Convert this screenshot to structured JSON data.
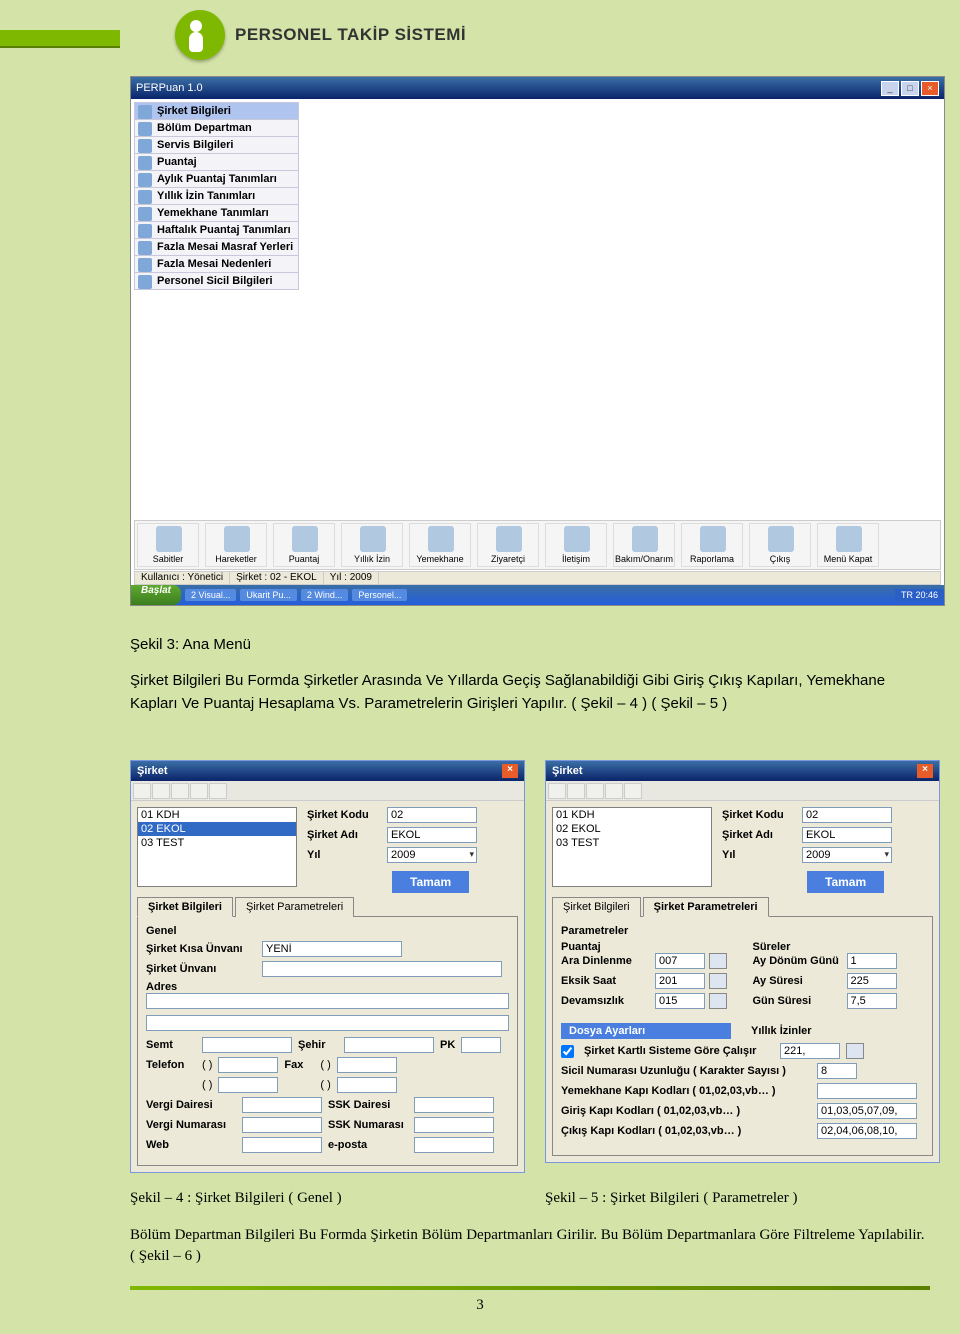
{
  "header": {
    "title": "PERSONEL TAKİP SİSTEMİ"
  },
  "paragraph1_title": "Şekil 3: Ana Menü",
  "paragraph1": "Şirket Bilgileri Bu Formda Şirketler Arasında Ve Yıllarda Geçiş Sağlanabildiği Gibi Giriş Çıkış Kapıları, Yemekhane Kapları Ve Puantaj Hesaplama Vs. Parametrelerin Girişleri Yapılır. ( Şekil – 4 ) ( Şekil – 5 )",
  "caption4": "Şekil – 4 : Şirket Bilgileri ( Genel )",
  "caption5": "Şekil – 5 : Şirket Bilgileri ( Parametreler )",
  "paragraph2": "Bölüm Departman Bilgileri Bu  Formda Şirketin  Bölüm  Departmanları  Girilir. Bu Bölüm Departmanlara Göre Filtreleme Yapılabilir. ( Şekil – 6 )",
  "page_num": "3",
  "mainwin": {
    "title": "PERPuan 1.0",
    "menu": [
      "Şirket Bilgileri",
      "Bölüm Departman",
      "Servis Bilgileri",
      "Puantaj",
      "Aylık Puantaj Tanımları",
      "Yıllık İzin Tanımları",
      "Yemekhane Tanımları",
      "Haftalık Puantaj Tanımları",
      "Fazla Mesai Masraf Yerleri",
      "Fazla Mesai Nedenleri",
      "Personel Sicil Bilgileri"
    ],
    "toolbar": [
      "Sabitler",
      "Hareketler",
      "Puantaj",
      "Yıllık İzin",
      "Yemekhane",
      "Ziyaretçi",
      "İletişim",
      "Bakım/Onarım",
      "Raporlama",
      "Çıkış",
      "Menü Kapat"
    ],
    "status": {
      "user": "Kullanıcı : Yönetici",
      "sirket": "Şirket : 02 - EKOL",
      "yil": "Yıl : 2009"
    },
    "start": "Başlat",
    "tasks": [
      "2 Visual...",
      "Ukarit Pu...",
      "2 Wind...",
      "Personel..."
    ],
    "tray": "TR    20:46"
  },
  "dlgL": {
    "title": "Şirket",
    "list": [
      "01 KDH",
      "02 EKOL",
      "03 TEST"
    ],
    "list_sel_index": 1,
    "kodu_lbl": "Şirket Kodu",
    "kodu": "02",
    "adi_lbl": "Şirket Adı",
    "adi": "EKOL",
    "yil_lbl": "Yıl",
    "yil": "2009",
    "btn": "Tamam",
    "tab1": "Şirket Bilgileri",
    "tab2": "Şirket Parametreleri",
    "grp": "Genel",
    "kisa_lbl": "Şirket Kısa Ünvanı",
    "kisa": "YENİ",
    "unvan_lbl": "Şirket Ünvanı",
    "adres_lbl": "Adres",
    "semt_lbl": "Semt",
    "sehir_lbl": "Şehir",
    "pk_lbl": "PK",
    "tel_lbl": "Telefon",
    "fax_lbl": "Fax",
    "vdairesi_lbl": "Vergi Dairesi",
    "sskd_lbl": "SSK Dairesi",
    "vno_lbl": "Vergi Numarası",
    "sskn_lbl": "SSK Numarası",
    "web_lbl": "Web",
    "email_lbl": "e-posta",
    "paren": "(   )"
  },
  "dlgR": {
    "title": "Şirket",
    "list": [
      "01 KDH",
      "02 EKOL",
      "03 TEST"
    ],
    "kodu_lbl": "Şirket Kodu",
    "kodu": "02",
    "adi_lbl": "Şirket Adı",
    "adi": "EKOL",
    "yil_lbl": "Yıl",
    "yil": "2009",
    "btn": "Tamam",
    "tab1": "Şirket Bilgileri",
    "tab2": "Şirket Parametreleri",
    "grp": "Parametreler",
    "puantaj_hdr": "Puantaj",
    "sureler_hdr": "Süreler",
    "ara_lbl": "Ara Dinlenme",
    "ara": "007",
    "eksik_lbl": "Eksik Saat",
    "eksik": "201",
    "devam_lbl": "Devamsızlık",
    "devam": "015",
    "aydg_lbl": "Ay Dönüm Günü",
    "aydg": "1",
    "ays_lbl": "Ay Süresi",
    "ays": "225",
    "guns_lbl": "Gün Süresi",
    "guns": "7,5",
    "dosya_hdr": "Dosya Ayarları",
    "yillik_hdr": "Yıllık İzinler",
    "chk_lbl": "Şirket Kartlı Sisteme Göre Çalışır",
    "yillik": "221,",
    "sicil_lbl": "Sicil Numarası Uzunluğu ( Karakter Sayısı )",
    "sicil": "8",
    "ykapi_lbl": "Yemekhane Kapı Kodları ( 01,02,03,vb… )",
    "gkapi_lbl": "Giriş Kapı Kodları ( 01,02,03,vb… )",
    "gkapi": "01,03,05,07,09,",
    "ckapi_lbl": "Çıkış Kapı Kodları ( 01,02,03,vb… )",
    "ckapi": "02,04,06,08,10,"
  }
}
